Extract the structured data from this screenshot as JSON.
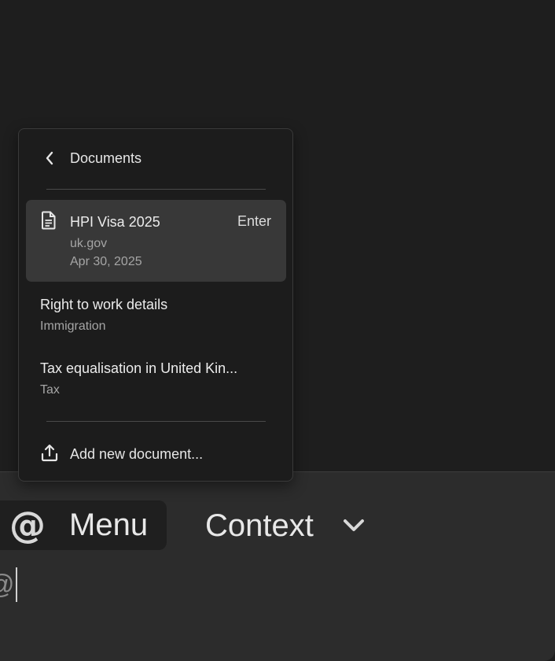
{
  "popover": {
    "title": "Documents",
    "items": [
      {
        "title": "HPI Visa 2025",
        "source": "uk.gov",
        "date": "Apr 30, 2025",
        "shortcut": "Enter",
        "icon": "document-icon",
        "selected": true
      },
      {
        "title": "Right to work details",
        "category": "Immigration"
      },
      {
        "title": "Tax equalisation in United Kin...",
        "category": "Tax"
      }
    ],
    "add_label": "Add new document..."
  },
  "composer": {
    "menu_symbol": "@",
    "menu_label": "Menu",
    "context_label": "Context",
    "input_value": "@"
  },
  "colors": {
    "background": "#1e1e1e",
    "popover_bg": "#1c1c1c",
    "selected_bg": "#383838",
    "panel_bg": "#2c2c2c",
    "chip_bg": "#1f1f1f"
  }
}
